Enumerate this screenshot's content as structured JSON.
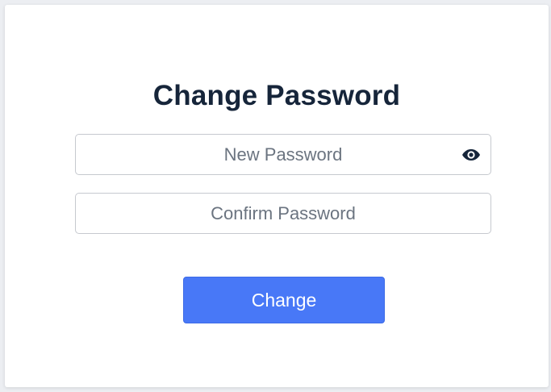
{
  "form": {
    "title": "Change Password",
    "new_password": {
      "placeholder": "New Password",
      "value": "",
      "toggle_icon": "eye-icon"
    },
    "confirm_password": {
      "placeholder": "Confirm Password",
      "value": ""
    },
    "submit_label": "Change"
  },
  "colors": {
    "accent": "#4878f7",
    "title": "#16253a",
    "placeholder": "#6b7480",
    "border": "#c6c9cf"
  }
}
